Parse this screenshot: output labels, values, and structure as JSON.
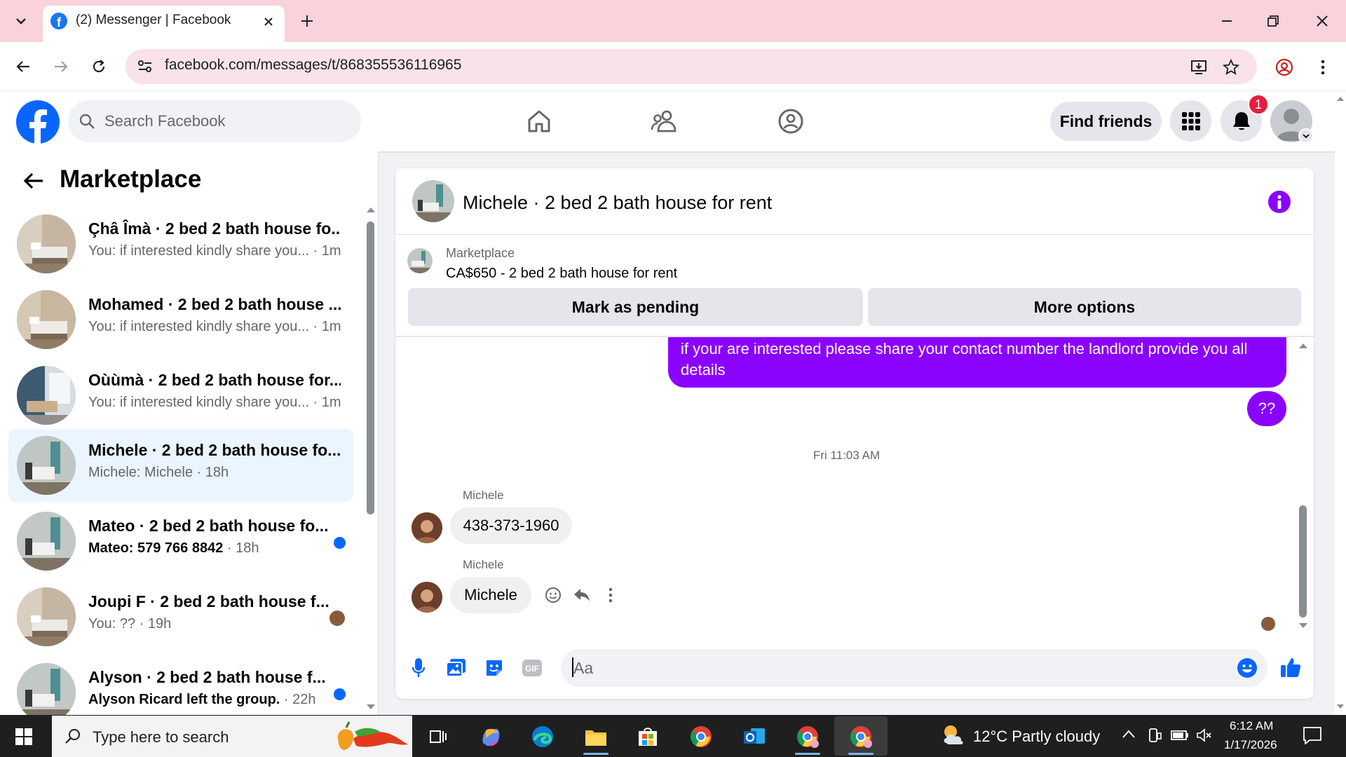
{
  "browser": {
    "tab_title": "(2) Messenger | Facebook",
    "url": "facebook.com/messages/t/868355536116965"
  },
  "fb_header": {
    "search_placeholder": "Search Facebook",
    "find_friends_label": "Find friends",
    "notification_count": "1"
  },
  "left_panel": {
    "title": "Marketplace",
    "conversations": [
      {
        "name": "Çhâ Îmà · 2 bed 2 bath house fo...",
        "preview": "You: if interested kindly share you...",
        "time": " · 1m",
        "unread": false,
        "active": false
      },
      {
        "name": "Mohamed · 2 bed 2 bath house ...",
        "preview": "You: if interested kindly share you...",
        "time": " · 1m",
        "unread": false,
        "active": false
      },
      {
        "name": "Oùùmà · 2 bed 2 bath house for...",
        "preview": "You: if interested kindly share you...",
        "time": " · 1m",
        "unread": false,
        "active": false
      },
      {
        "name": "Michele · 2 bed 2 bath house fo...",
        "preview": "Michele: Michele",
        "time": " · 18h",
        "unread": false,
        "active": true
      },
      {
        "name": "Mateo · 2 bed 2 bath house fo...",
        "preview": "Mateo: 579 766 8842",
        "time": " · 18h",
        "unread": true,
        "active": false
      },
      {
        "name": "Joupi F · 2 bed 2 bath house f...",
        "preview": "You: ??",
        "time": " · 19h",
        "unread": false,
        "active": false
      },
      {
        "name": "Alyson · 2 bed 2 bath house f...",
        "preview": "Alyson Ricard left the group.",
        "time": " · 22h",
        "unread": true,
        "active": false
      }
    ]
  },
  "chat": {
    "title": "Michele · 2 bed 2 bath house for rent",
    "marketplace_label": "Marketplace",
    "listing": "CA$650 - 2 bed 2 bath house for rent",
    "mark_pending_label": "Mark as pending",
    "more_options_label": "More options",
    "messages": {
      "out_1": "if your are interested please share your contact number the landlord provide you all details",
      "out_2": "??",
      "timestamp": "Fri 11:03 AM",
      "in_1_sender": "Michele",
      "in_1_text": "438-373-1960",
      "in_2_sender": "Michele",
      "in_2_text": "Michele"
    },
    "composer_placeholder": "Aa"
  },
  "taskbar": {
    "search_placeholder": "Type here to search",
    "weather": "12°C  Partly cloudy",
    "time": "6:12 AM",
    "date": "1/17/2026"
  },
  "colors": {
    "facebook_blue": "#0866ff",
    "messenger_purple": "#8a03ff",
    "badge_red": "#e41e3f",
    "chrome_pink": "#f9d2db"
  }
}
